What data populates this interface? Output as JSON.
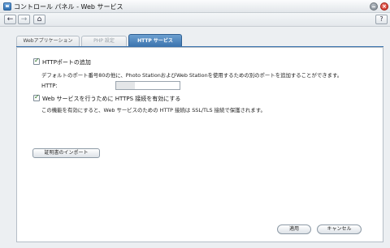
{
  "window": {
    "title": "コントロール パネル - Web サービス",
    "minimize_label": "",
    "close_label": "×"
  },
  "toolbar": {
    "back_label": "←",
    "forward_label": "→",
    "home_label": "⌂",
    "help_label": "?"
  },
  "tabs": [
    {
      "label": "Webアプリケーション"
    },
    {
      "label": "PHP 設定"
    },
    {
      "label": "HTTP サービス"
    }
  ],
  "http_port": {
    "checkbox_label": "HTTPポートの追加",
    "checked": true,
    "description": "デフォルトのポート番号80の他に、Photo StationおよびWeb Stationを使用するための別のポートを追加することができます。",
    "field_label": "HTTP:",
    "value": ""
  },
  "https": {
    "checkbox_label": "Web サービスを行うために HTTPS 接続を有効にする",
    "checked": true,
    "description": "この機能を有効にすると、Web サービスのための HTTP 接続は SSL/TLS 接続で保護されます。",
    "import_button": "証明書のインポート"
  },
  "footer": {
    "apply_label": "適用",
    "cancel_label": "キャンセル"
  }
}
